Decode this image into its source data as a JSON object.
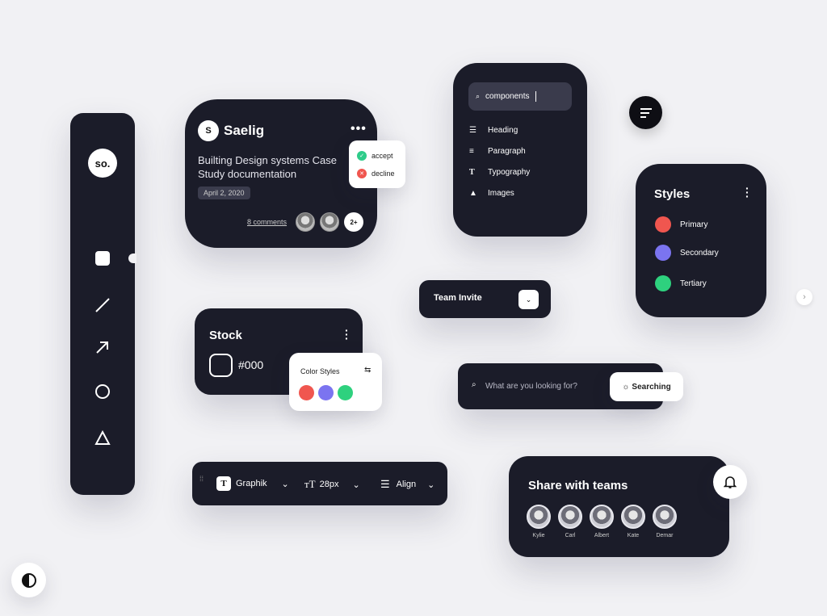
{
  "sidebar": {
    "logo": "so.",
    "tools": [
      "square-tool",
      "line-tool",
      "arrow-tool",
      "circle-tool",
      "triangle-tool"
    ]
  },
  "post": {
    "avatar_letter": "S",
    "name": "Saelig",
    "title_line1": "Builting Design systems Case",
    "title_line2": "Study documentation",
    "date": "April 2, 2020",
    "comments": "8 comments",
    "more_count": "2+"
  },
  "decision": {
    "accept": "accept",
    "decline": "decline",
    "accept_color": "#2ecc8a",
    "decline_color": "#f0564f"
  },
  "components": {
    "search_value": "components",
    "items": [
      {
        "icon": "heading-icon",
        "label": "Heading"
      },
      {
        "icon": "paragraph-icon",
        "label": "Paragraph"
      },
      {
        "icon": "typography-icon",
        "label": "Typography"
      },
      {
        "icon": "images-icon",
        "label": "Images"
      }
    ]
  },
  "styles": {
    "title": "Styles",
    "items": [
      {
        "label": "Primary",
        "color": "#f0564f"
      },
      {
        "label": "Secondary",
        "color": "#7b74f0"
      },
      {
        "label": "Tertiary",
        "color": "#2ed17e"
      }
    ]
  },
  "team_invite": {
    "label": "Team Invite"
  },
  "stock": {
    "title": "Stock",
    "value": "#000"
  },
  "color_styles": {
    "title": "Color Styles",
    "colors": [
      "#f0564f",
      "#7b74f0",
      "#2ed17e"
    ]
  },
  "search": {
    "placeholder": "What are you looking for?",
    "button": "Searching"
  },
  "toolbar": {
    "font": "Graphik",
    "size": "28px",
    "align": "Align"
  },
  "share": {
    "title": "Share with teams",
    "people": [
      "Kylie",
      "Carl",
      "Albert",
      "Kate",
      "Demar"
    ]
  }
}
